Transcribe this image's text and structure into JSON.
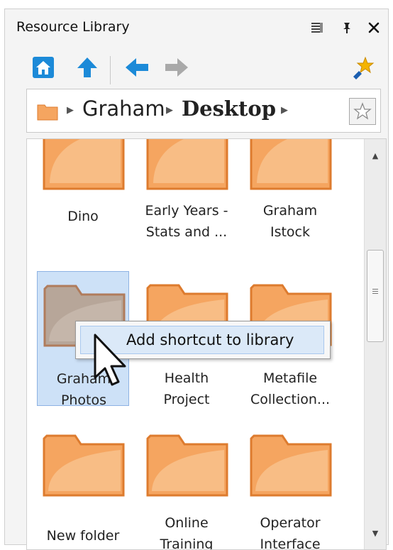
{
  "window": {
    "title": "Resource Library",
    "menu_icon": "list-menu-icon",
    "pin_icon": "pin-icon",
    "close_icon": "close-icon"
  },
  "toolbar": {
    "home_icon": "home-icon",
    "up_icon": "up-arrow-icon",
    "back_icon": "back-arrow-icon",
    "forward_icon": "forward-arrow-icon",
    "add_favorite_icon": "pin-star-icon"
  },
  "breadcrumb": {
    "items": [
      "Graham",
      "Desktop"
    ],
    "star_icon": "star-icon"
  },
  "content": {
    "items": [
      {
        "label_lines": [
          "",
          "Dino"
        ]
      },
      {
        "label_lines": [
          "Early Years -",
          "Stats and ..."
        ]
      },
      {
        "label_lines": [
          "Graham",
          "Istock"
        ]
      },
      {
        "label_lines": [
          "Graham",
          "Photos"
        ],
        "selected": true
      },
      {
        "label_lines": [
          "Health",
          "Project"
        ]
      },
      {
        "label_lines": [
          "Metafile",
          "Collection..."
        ]
      },
      {
        "label_lines": [
          "",
          "New folder"
        ]
      },
      {
        "label_lines": [
          "Online",
          "Training"
        ]
      },
      {
        "label_lines": [
          "Operator",
          "Interface"
        ]
      }
    ]
  },
  "context_menu": {
    "items": [
      {
        "label": "Add shortcut to library"
      }
    ]
  },
  "colors": {
    "folder_orange": "#f5a560",
    "folder_border": "#dd7b2e",
    "selection": "#cde1f7",
    "toolbar_blue": "#1c8ad8"
  }
}
